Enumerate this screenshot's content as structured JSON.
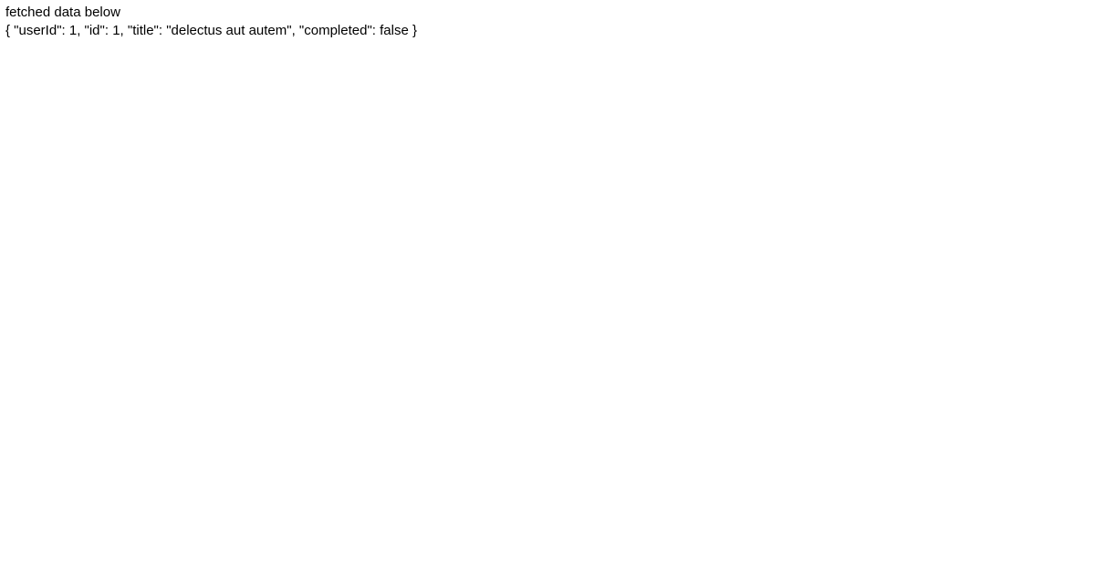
{
  "heading": "fetched data below",
  "json_text": "{ \"userId\": 1, \"id\": 1, \"title\": \"delectus aut autem\", \"completed\": false }"
}
